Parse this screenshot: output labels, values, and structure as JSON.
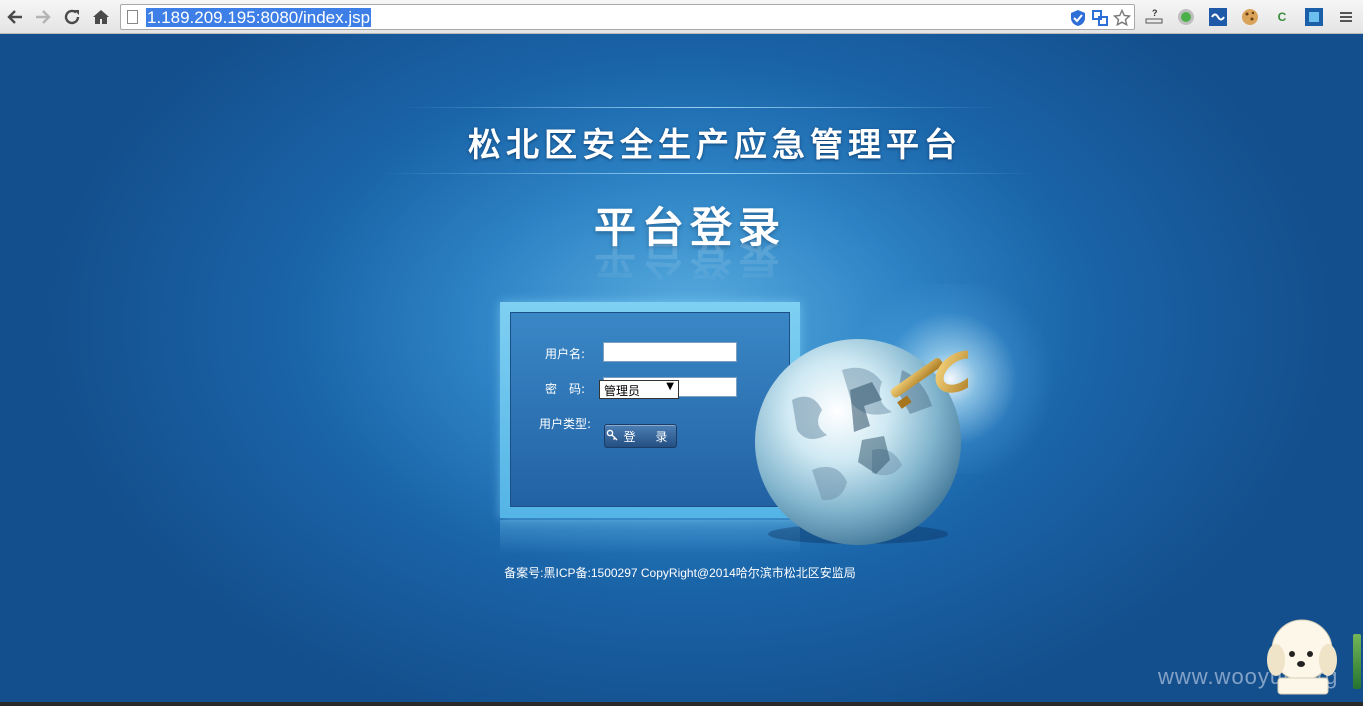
{
  "browser": {
    "url": "1.189.209.195:8080/index.jsp",
    "back_icon": "back-arrow-icon",
    "forward_icon": "forward-arrow-icon",
    "reload_icon": "reload-icon",
    "home_icon": "home-icon",
    "extensions": [
      "shield-check-icon",
      "translate-icon",
      "star-icon",
      "question-icon",
      "green-dot-icon",
      "blue-wave-icon",
      "cookie-icon",
      "letter-c-icon",
      "blue-box-icon",
      "menu-icon"
    ]
  },
  "page": {
    "main_title": "松北区安全生产应急管理平台",
    "sub_title": "平台登录",
    "form": {
      "username_label": "用户名:",
      "password_label": "密　码:",
      "usertype_label": "用户类型:",
      "usertype_selected": "管理员",
      "login_button": "登 录"
    },
    "footer": "备案号:黑ICP备:1500297 CopyRight@2014哈尔滨市松北区安监局"
  },
  "watermark": "www.wooyun.org",
  "colors": {
    "background": "#1a64a8",
    "frame": "#6ec4ee",
    "url_highlight": "#3d7fe6"
  }
}
